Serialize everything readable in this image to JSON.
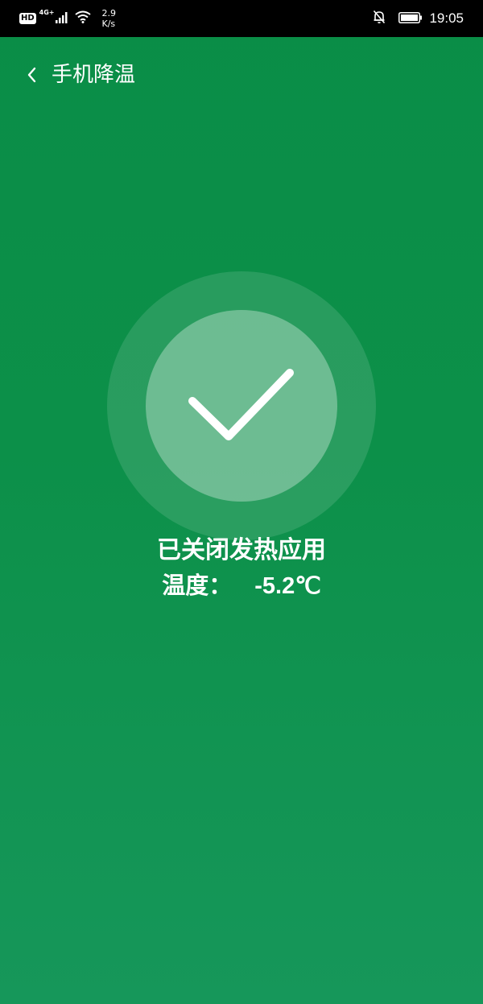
{
  "status_bar": {
    "hd": "HD",
    "network": "4G+",
    "speed_value": "2.9",
    "speed_unit": "K/s",
    "time": "19:05",
    "icons": [
      "signal-icon",
      "wifi-icon",
      "bell-off-icon",
      "battery-icon"
    ]
  },
  "header": {
    "title": "手机降温",
    "back_icon": "chevron-left-icon"
  },
  "result": {
    "icon": "check-icon",
    "message": "已关闭发热应用",
    "temp_label": "温度：",
    "temp_value": "-5.2℃"
  },
  "colors": {
    "background": "#0c9049",
    "text": "#ffffff",
    "status_bar": "#000000"
  }
}
